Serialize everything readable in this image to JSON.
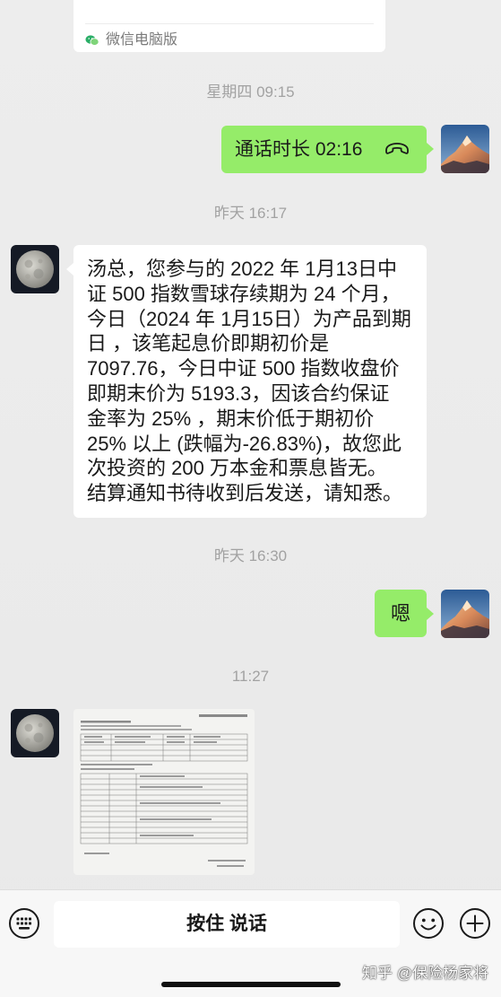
{
  "chat": {
    "partial_file_card": {
      "source_label": "微信电脑版",
      "source_icon": "wechat-icon"
    },
    "timestamps": [
      "星期四 09:15",
      "昨天 16:17",
      "昨天 16:30",
      "11:27"
    ],
    "call_record": {
      "text": "通话时长 02:16",
      "icon": "phone-hangup-icon"
    },
    "contact_message": {
      "lines": [
        "汤总，您参与的 2022 年 1月13日中",
        "证 500 指数雪球存续期为 24 个月，",
        "今日（2024 年 1月15日）为产品到期",
        "日 ，该笔起息价即期初价是",
        "7097.76，今日中证 500 指数收盘价",
        "即期末价为 5193.3，因该合约保证",
        "金率为 25% ，期末价低于期初价",
        "25% 以上 (跌幅为-26.83%)，故您此",
        "次投资的 200 万本金和票息皆无。",
        "结算通知书待收到后发送，请知悉。"
      ]
    },
    "reply_message": {
      "text": "嗯"
    },
    "image_message": {
      "image": "settlement-notice-document-image"
    },
    "avatars": {
      "self": "snowy-mountain-avatar",
      "contact": "moon-avatar"
    }
  },
  "input_bar": {
    "keyboard_icon": "keyboard-icon",
    "hold_to_talk_label": "按住 说话",
    "emoji_icon": "emoji-icon",
    "more_icon": "plus-circle-icon"
  },
  "watermark": {
    "text": "知乎 @保险杨家将"
  },
  "colors": {
    "chat_background": "#ebebeb",
    "sent_bubble": "#95ec69",
    "received_bubble": "#ffffff",
    "timestamp_text": "#a2a2a2",
    "input_bar": "#f7f7f7"
  }
}
